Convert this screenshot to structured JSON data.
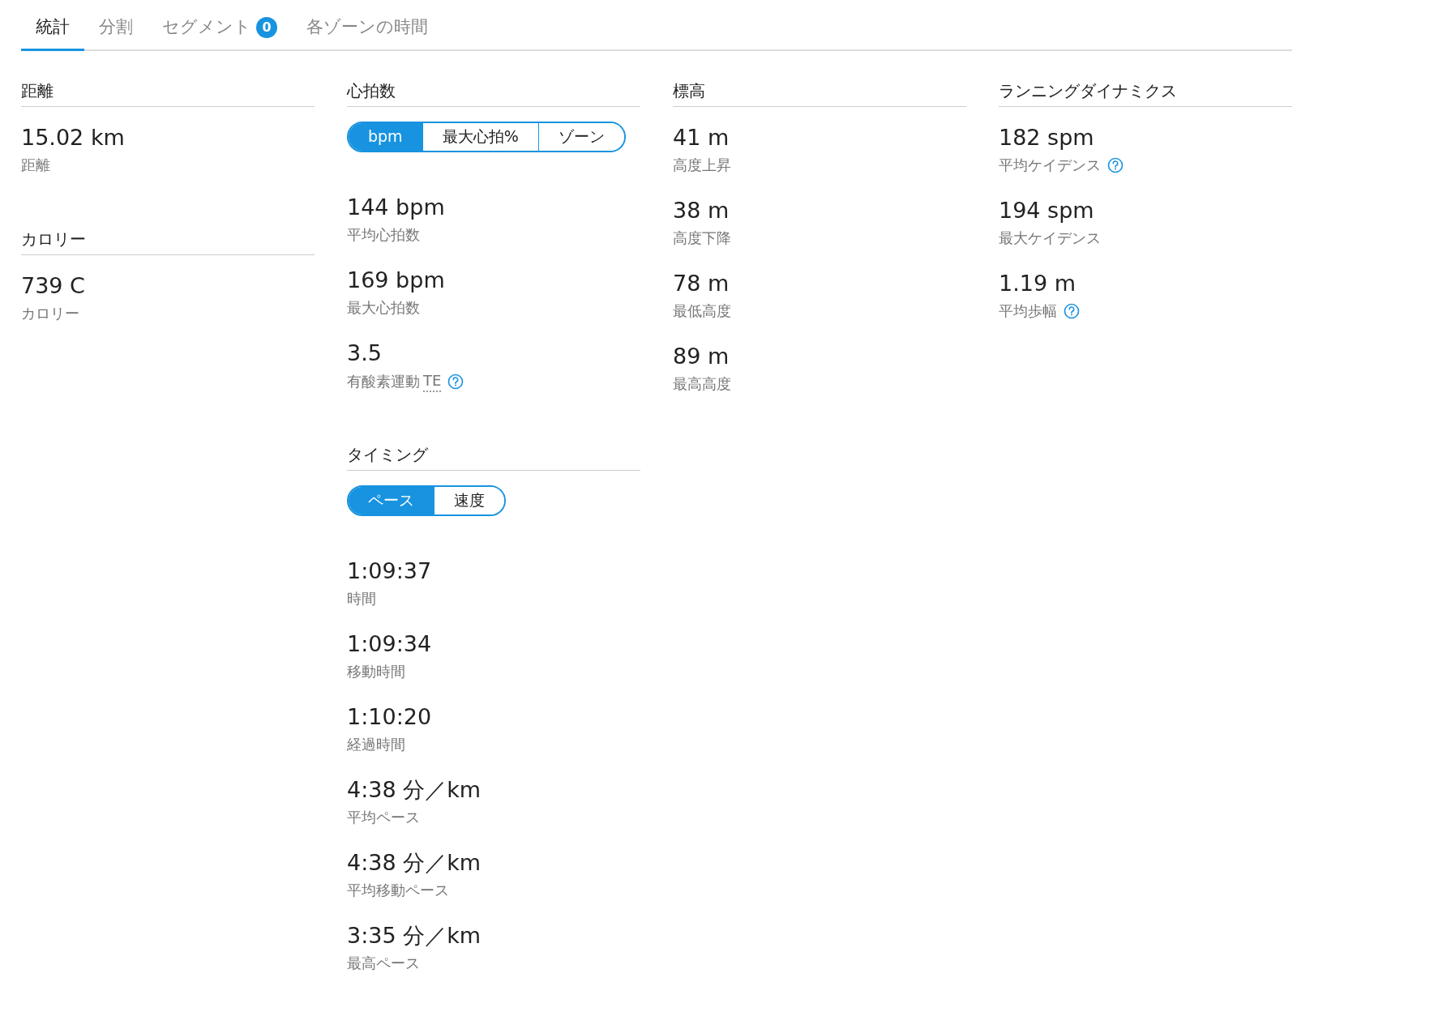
{
  "tabs": [
    {
      "label": "統計",
      "selected": true
    },
    {
      "label": "分割",
      "selected": false
    },
    {
      "label": "セグメント",
      "selected": false,
      "badge": "0"
    },
    {
      "label": "各ゾーンの時間",
      "selected": false
    }
  ],
  "columns": [
    [
      {
        "title": "距離",
        "stats": [
          {
            "value": "15.02 km",
            "label": "距離"
          }
        ]
      },
      {
        "title": "カロリー",
        "stats": [
          {
            "value": "739 C",
            "label": "カロリー"
          }
        ]
      }
    ],
    [
      {
        "title": "心拍数",
        "toggle": [
          {
            "label": "bpm",
            "selected": true
          },
          {
            "label": "最大心拍%",
            "selected": false
          },
          {
            "label": "ゾーン",
            "selected": false
          }
        ],
        "stats": [
          {
            "value": "144 bpm",
            "label": "平均心拍数"
          },
          {
            "value": "169 bpm",
            "label": "最大心拍数"
          },
          {
            "value": "3.5",
            "label": "有酸素運動",
            "abbr": "TE",
            "help": true
          }
        ]
      },
      {
        "title": "タイミング",
        "toggle": [
          {
            "label": "ペース",
            "selected": true
          },
          {
            "label": "速度",
            "selected": false
          }
        ],
        "stats": [
          {
            "value": "1:09:37",
            "label": "時間"
          },
          {
            "value": "1:09:34",
            "label": "移動時間"
          },
          {
            "value": "1:10:20",
            "label": "経過時間"
          },
          {
            "value": "4:38 分／km",
            "label": "平均ペース"
          },
          {
            "value": "4:38 分／km",
            "label": "平均移動ペース"
          },
          {
            "value": "3:35 分／km",
            "label": "最高ペース"
          }
        ]
      }
    ],
    [
      {
        "title": "標高",
        "stats": [
          {
            "value": "41 m",
            "label": "高度上昇"
          },
          {
            "value": "38 m",
            "label": "高度下降"
          },
          {
            "value": "78 m",
            "label": "最低高度"
          },
          {
            "value": "89 m",
            "label": "最高高度"
          }
        ]
      }
    ],
    [
      {
        "title": "ランニングダイナミクス",
        "stats": [
          {
            "value": "182 spm",
            "label": "平均ケイデンス",
            "help": true
          },
          {
            "value": "194 spm",
            "label": "最大ケイデンス"
          },
          {
            "value": "1.19 m",
            "label": "平均歩幅",
            "help": true
          }
        ]
      }
    ]
  ]
}
